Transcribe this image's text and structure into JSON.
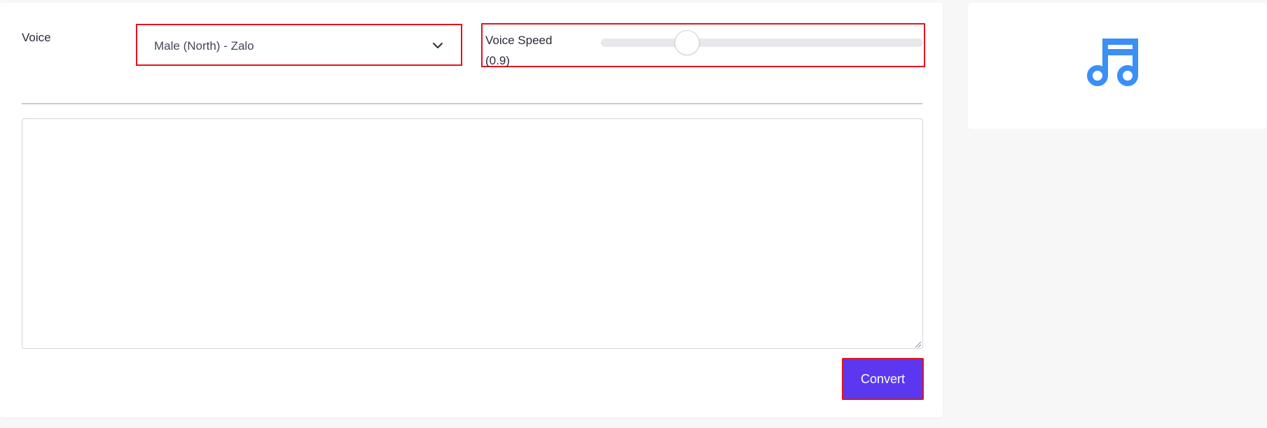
{
  "voice": {
    "label": "Voice",
    "selected": "Male (North) - Zalo"
  },
  "speed": {
    "label": "Voice Speed",
    "value_text": "(0.9)",
    "value": 0.9,
    "min": 0.5,
    "max": 2.0
  },
  "text_input": {
    "value": "",
    "placeholder": ""
  },
  "actions": {
    "convert_label": "Convert"
  },
  "colors": {
    "accent": "#5b38f0",
    "highlight_border": "#e3131f",
    "icon": "#3b8ff5"
  },
  "icons": {
    "select": "chevron-down-icon",
    "preview": "music-note-icon"
  }
}
